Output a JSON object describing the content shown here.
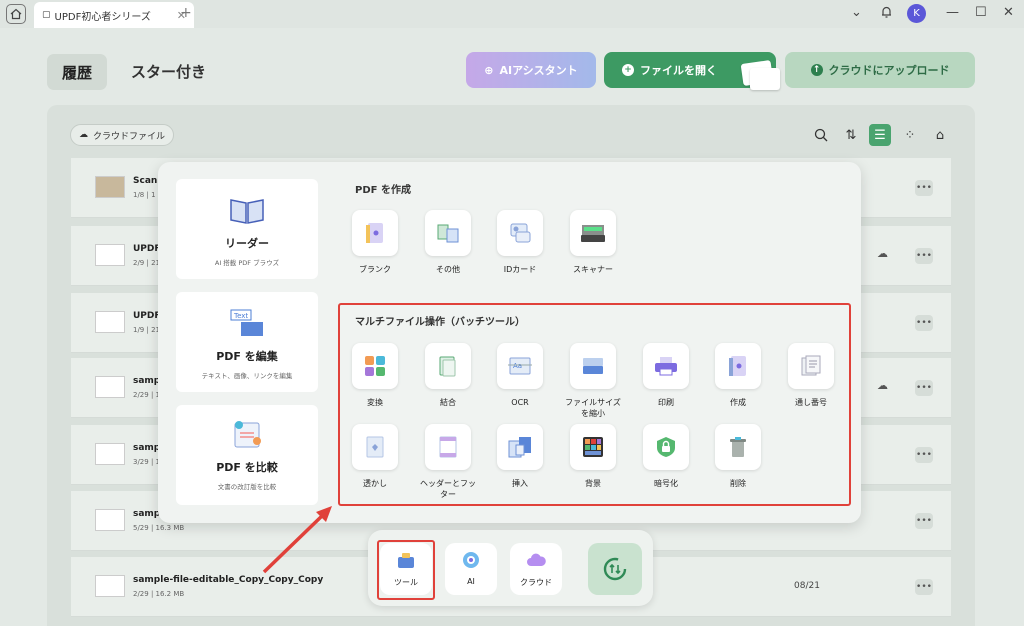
{
  "titlebar": {
    "tab_label": "UPDF初心者シリーズ",
    "avatar_initial": "K"
  },
  "header": {
    "history_tab": "履歴",
    "starred_tab": "スター付き",
    "ai_button": "AIアシスタント",
    "open_button": "ファイルを開く",
    "cloud_button": "クラウドにアップロード"
  },
  "toolbar": {
    "cloud_files": "クラウドファイル"
  },
  "files": [
    {
      "name": "Scann",
      "meta": "1/8 | 1"
    },
    {
      "name": "UPDF",
      "meta": "2/9 | 21"
    },
    {
      "name": "UPDF",
      "meta": "1/9 | 21"
    },
    {
      "name": "sampl",
      "meta": "2/29 | 1"
    },
    {
      "name": "sampl",
      "meta": "3/29 | 1"
    },
    {
      "name": "sample",
      "meta": "5/29 | 16.3 MB"
    },
    {
      "name": "sample-file-editable_Copy_Copy_Copy",
      "meta": "2/29 | 16.2 MB",
      "date": "08/21"
    }
  ],
  "popup": {
    "cards": [
      {
        "title": "リーダー",
        "sub": "AI 搭載 PDF ブラウズ"
      },
      {
        "title": "PDF を編集",
        "sub": "テキスト、画像、リンクを編集"
      },
      {
        "title": "PDF を比較",
        "sub": "文書の改訂版を比較"
      }
    ],
    "create_title": "PDF を作成",
    "create_tools": [
      "ブランク",
      "その他",
      "IDカード",
      "スキャナー"
    ],
    "batch_title": "マルチファイル操作（バッチツール）",
    "batch_row1": [
      "変換",
      "結合",
      "OCR",
      "ファイルサイズを縮小",
      "印刷",
      "作成",
      "通し番号"
    ],
    "batch_row2": [
      "透かし",
      "ヘッダーとフッター",
      "挿入",
      "背景",
      "暗号化",
      "削除"
    ]
  },
  "dock": {
    "tools": "ツール",
    "ai": "AI",
    "cloud": "クラウド"
  },
  "colors": {
    "accent": "#3d9a63",
    "highlight": "#e0413a"
  }
}
